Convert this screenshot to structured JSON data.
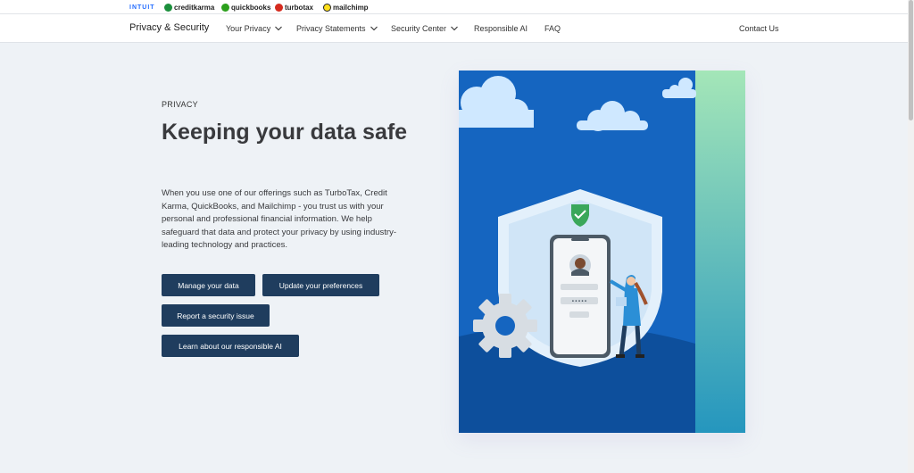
{
  "brand_bar": {
    "brands": [
      {
        "label": "INTUIT",
        "color": "#236cff"
      },
      {
        "label": "creditkarma",
        "color": "#1b8f3c"
      },
      {
        "label": "quickbooks",
        "color": "#2ca01c"
      },
      {
        "label": "turbotax",
        "color": "#d52b1e"
      },
      {
        "label": "mailchimp",
        "color": "#ffe01b"
      }
    ]
  },
  "nav": {
    "title": "Privacy & Security",
    "items": [
      {
        "label": "Your Privacy",
        "has_dropdown": true,
        "icon": "chevron-down-icon"
      },
      {
        "label": "Privacy Statements",
        "has_dropdown": true,
        "icon": "chevron-down-icon"
      },
      {
        "label": "Security Center",
        "has_dropdown": true,
        "icon": "chevron-down-icon"
      },
      {
        "label": "Responsible AI",
        "has_dropdown": false
      },
      {
        "label": "FAQ",
        "has_dropdown": false
      }
    ],
    "contact": "Contact Us"
  },
  "hero": {
    "eyebrow": "PRIVACY",
    "headline": "Keeping your data safe",
    "description": "When you use one of our offerings such as TurboTax, Credit Karma, QuickBooks, and Mailchimp - you trust us with your personal and professional financial information. We help safeguard that data and protect your privacy by using industry-leading technology and practices.",
    "buttons": [
      {
        "label": "Manage your data"
      },
      {
        "label": "Update your preferences"
      },
      {
        "label": "Report a security issue"
      },
      {
        "label": "Learn about our responsible AI"
      }
    ],
    "illustration": {
      "password_mask": "•••••",
      "icons": [
        "cloud-icon",
        "shield-icon",
        "check-icon",
        "phone-icon",
        "avatar-icon",
        "gear-icon",
        "person-icon"
      ]
    }
  },
  "colors": {
    "button_bg": "#1f3d5e",
    "illustration_blue": "#1565c0",
    "illustration_accent": "#9fe0b4",
    "page_bg": "#eef2f6"
  }
}
